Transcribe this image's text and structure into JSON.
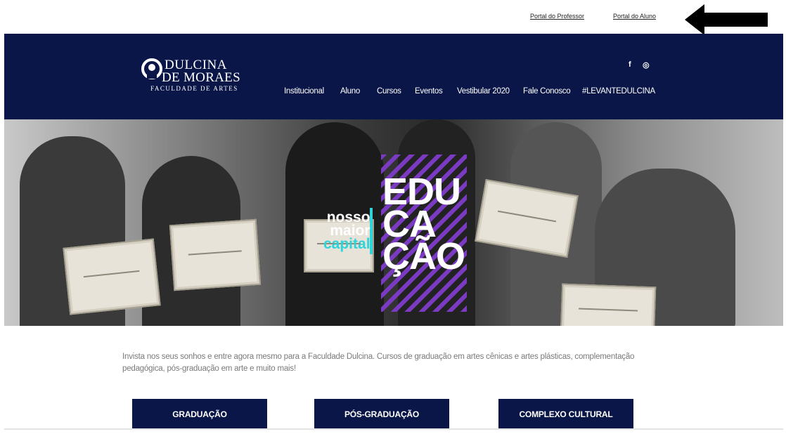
{
  "topbar": {
    "links": [
      "Portal do Professor",
      "Portal do Aluno"
    ]
  },
  "logo": {
    "line1": "Dulcina",
    "line2": "de Moraes",
    "line3": "FACULDADE DE ARTES"
  },
  "nav": {
    "items": [
      "Institucional",
      "Aluno",
      "Cursos",
      "Eventos",
      "Vestibular 2020",
      "Fale Conosco",
      "#LEVANTEDULCINA"
    ]
  },
  "social": {
    "facebook": "f",
    "instagram": "◎"
  },
  "hero": {
    "tagline": [
      "nosso",
      "maior",
      "capital"
    ],
    "headline": [
      "EDU",
      "CA",
      "ÇÃO"
    ]
  },
  "intro": {
    "text": "Invista nos seus sonhos e entre agora mesmo para a Faculdade Dulcina. Cursos de graduação em artes cênicas e artes plásticas, complementação pedagógica, pós-graduação em arte e muito mais!"
  },
  "buttons": [
    "GRADUAÇÃO",
    "PÓS-GRADUAÇÃO",
    "COMPLEXO CULTURAL"
  ],
  "colors": {
    "navy": "#0a1647",
    "cyan": "#2fd4d8",
    "purple": "#7a3ac2"
  }
}
